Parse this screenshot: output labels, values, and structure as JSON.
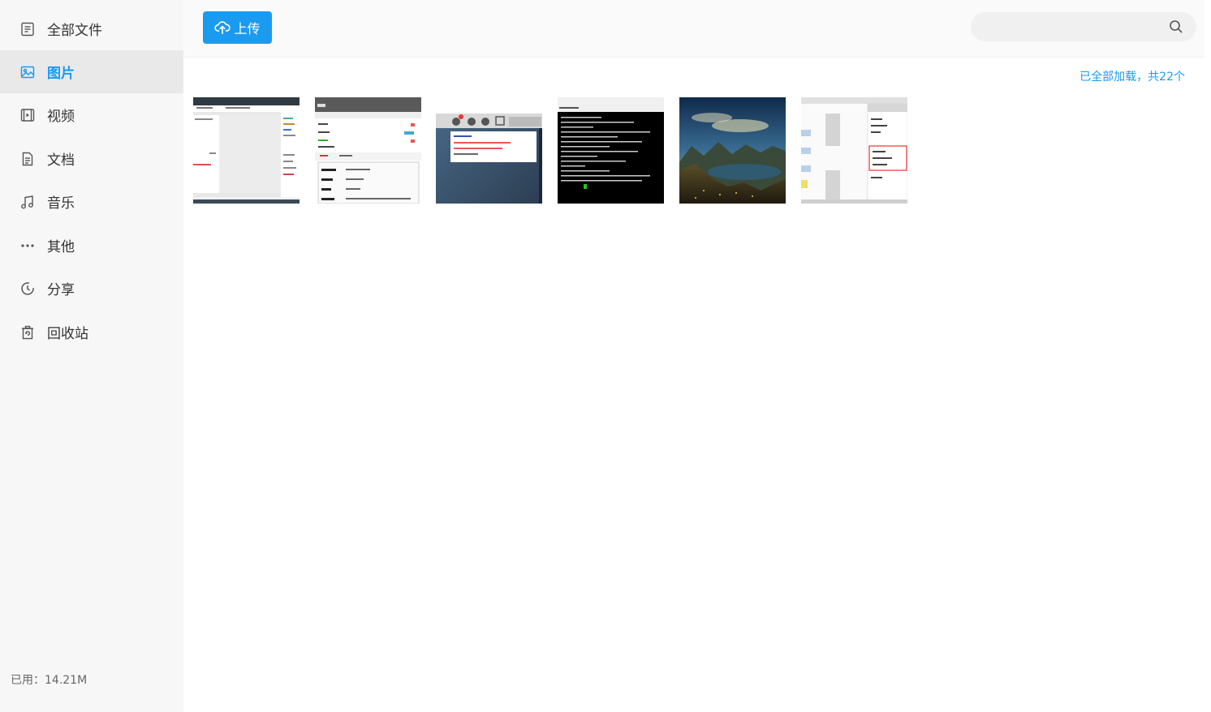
{
  "sidebar": {
    "items": [
      {
        "label": "全部文件",
        "icon": "file-list-icon"
      },
      {
        "label": "图片",
        "icon": "image-icon"
      },
      {
        "label": "视频",
        "icon": "video-icon"
      },
      {
        "label": "文档",
        "icon": "document-icon"
      },
      {
        "label": "音乐",
        "icon": "music-icon"
      },
      {
        "label": "其他",
        "icon": "more-icon"
      },
      {
        "label": "分享",
        "icon": "share-icon"
      },
      {
        "label": "回收站",
        "icon": "trash-icon"
      }
    ],
    "active_index": 1,
    "storage_used": "已用：14.21M"
  },
  "toolbar": {
    "upload_label": "上传",
    "search_placeholder": ""
  },
  "content": {
    "status_text": "已全部加载，共22个",
    "thumbnails": [
      {
        "name": "screenshot-app-window"
      },
      {
        "name": "screenshot-settings-dialog"
      },
      {
        "name": "screenshot-chat-client"
      },
      {
        "name": "screenshot-terminal"
      },
      {
        "name": "landscape-photo"
      },
      {
        "name": "screenshot-flowchart-editor"
      }
    ]
  },
  "colors": {
    "accent": "#1a9bf0",
    "sidebar_bg": "#f7f7f7",
    "active_bg": "#e9e9e9"
  }
}
